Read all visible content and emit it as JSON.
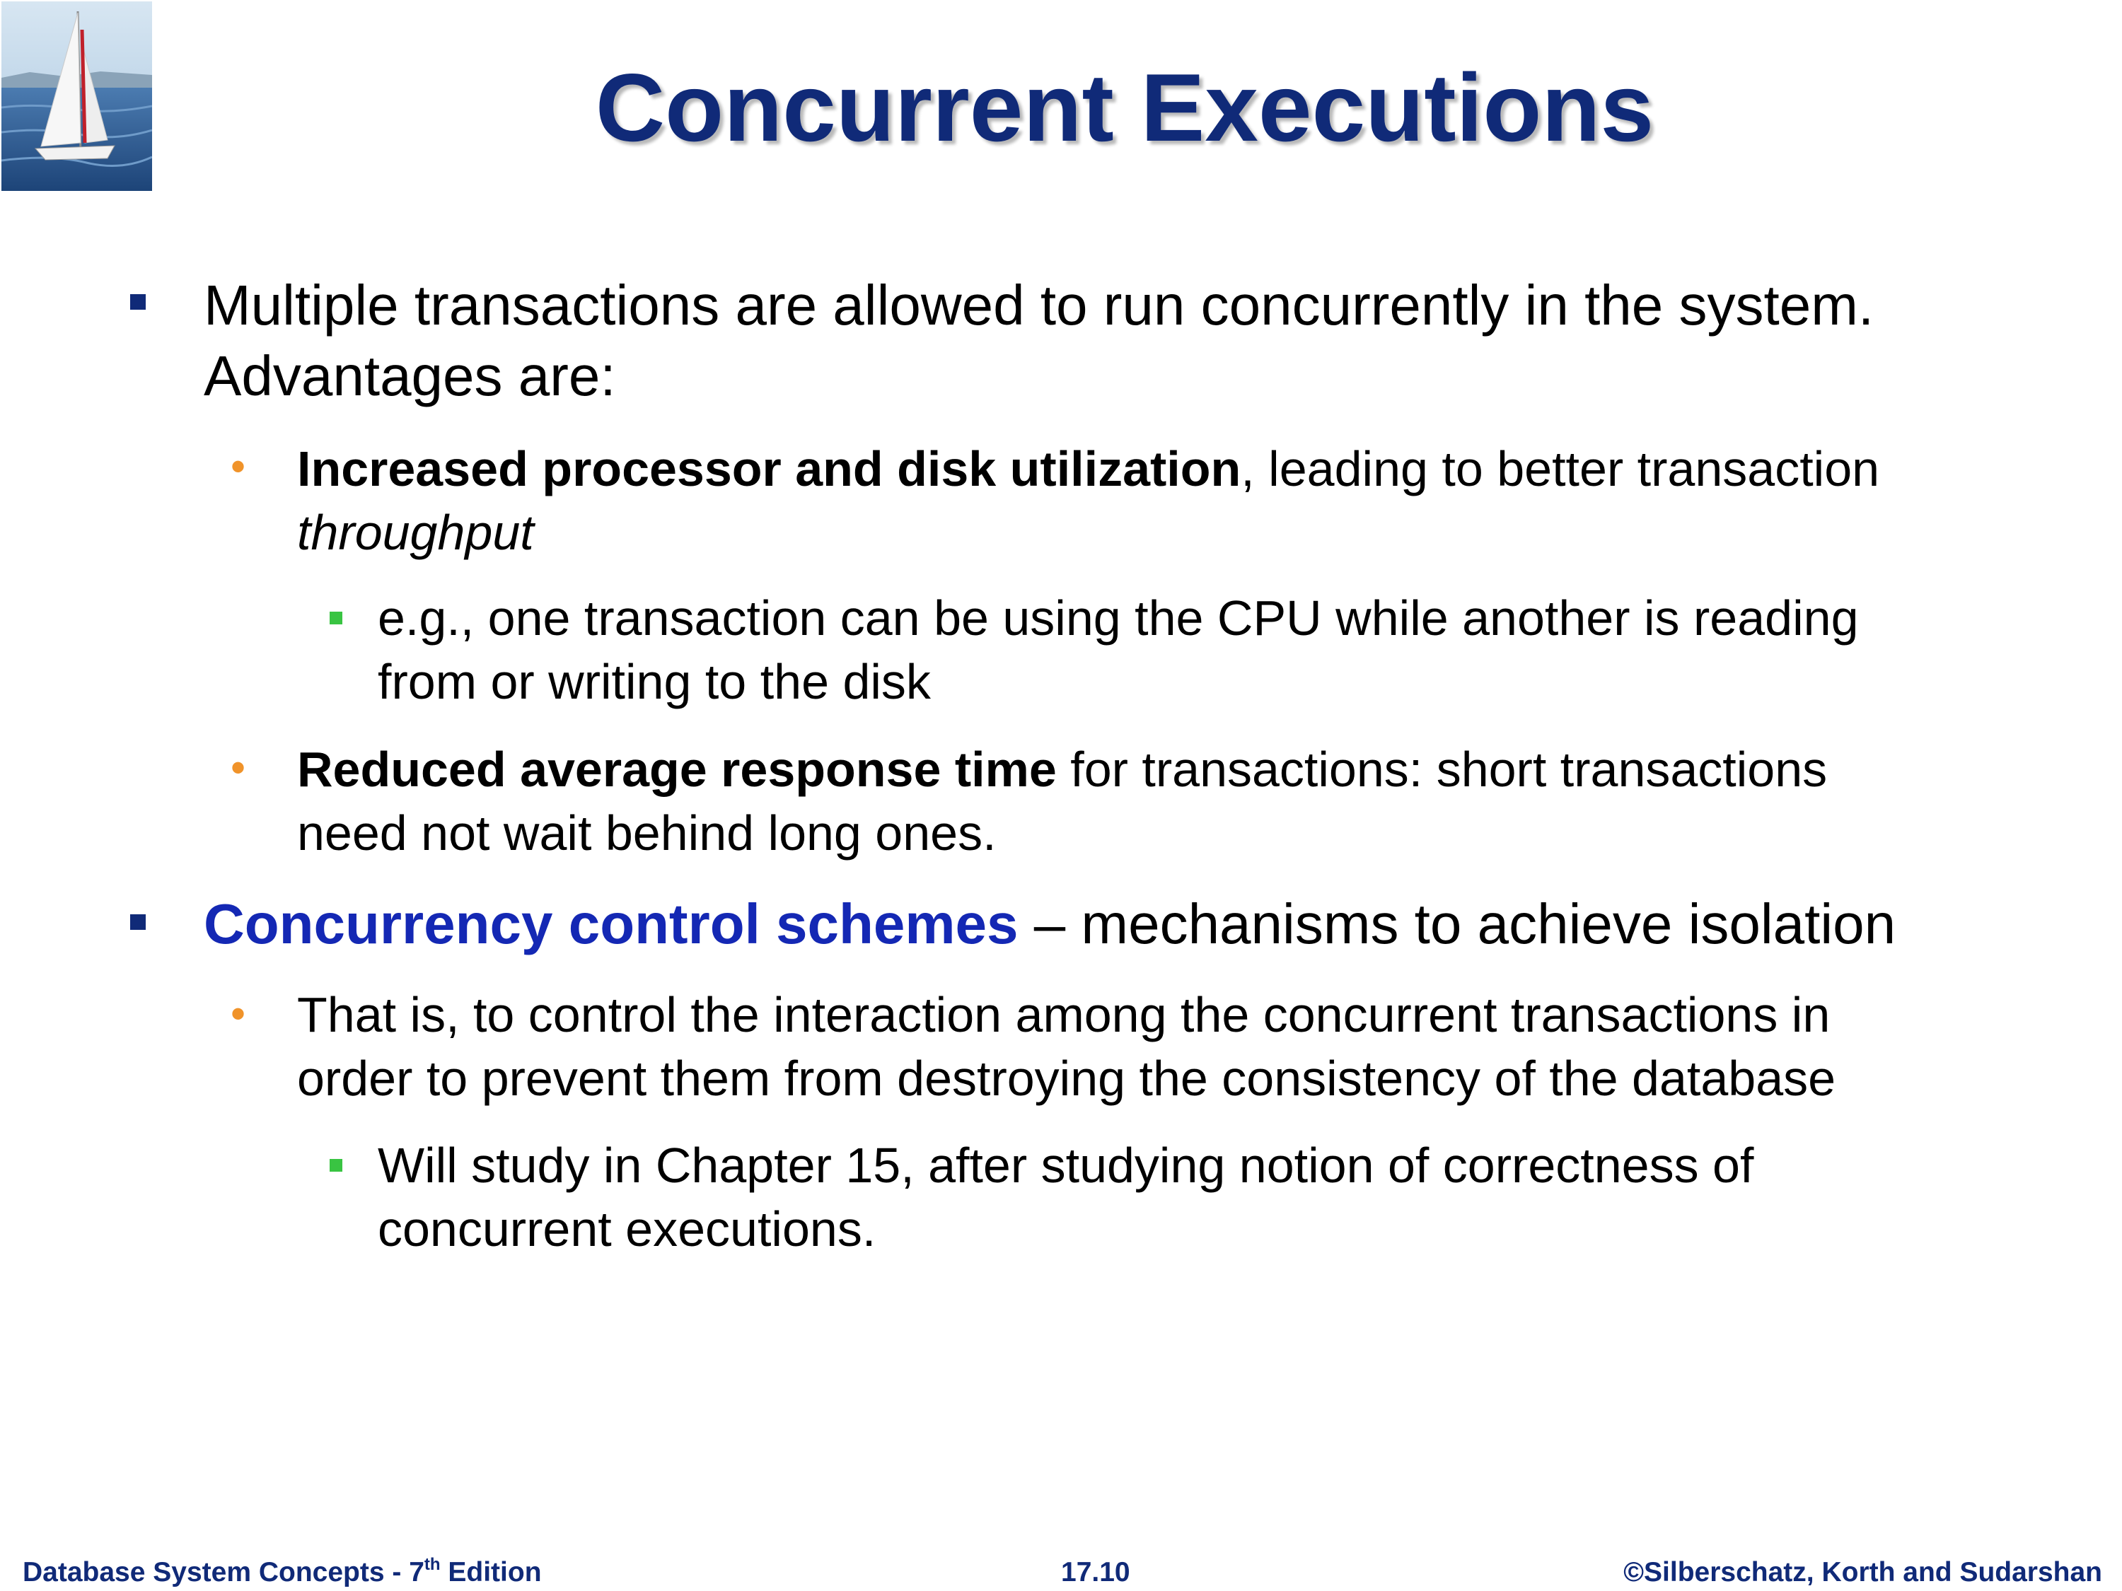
{
  "slide": {
    "title": "Concurrent Executions",
    "bullets": {
      "b1_text": "Multiple transactions are allowed to run concurrently in the system.",
      "b1_cont": "Advantages are:",
      "b1a_bold": "Increased processor and disk utilization",
      "b1a_rest": ", leading to better transaction",
      "b1a_italic": "throughput",
      "b1a1_line1": "e.g., one transaction can be using the CPU while another is reading",
      "b1a1_line2": "from or writing to the disk",
      "b1b_bold": "Reduced average response time",
      "b1b_rest": " for transactions: short transactions",
      "b1b_line2": "need not wait behind long ones.",
      "b2_blue": "Concurrency control schemes",
      "b2_rest": " – mechanisms  to achieve isolation",
      "b2a_line1": "That is, to control the interaction among the concurrent transactions in",
      "b2a_line2": "order to prevent them from destroying the consistency of the database",
      "b2a1_line1": "Will study in Chapter 15, after studying notion of correctness of",
      "b2a1_line2": "concurrent executions."
    }
  },
  "footer": {
    "left_prefix": "Database System Concepts - 7",
    "left_sup": "th",
    "left_suffix": " Edition",
    "center": "17.10",
    "right": "©Silberschatz, Korth and Sudarshan"
  },
  "colors": {
    "title": "#102a78",
    "accent_blue": "#1428b4",
    "bullet_level1": "#102a78",
    "bullet_level2": "#f0932a",
    "bullet_level3": "#39c442"
  },
  "icons": {
    "logo": "sailboat-icon"
  }
}
